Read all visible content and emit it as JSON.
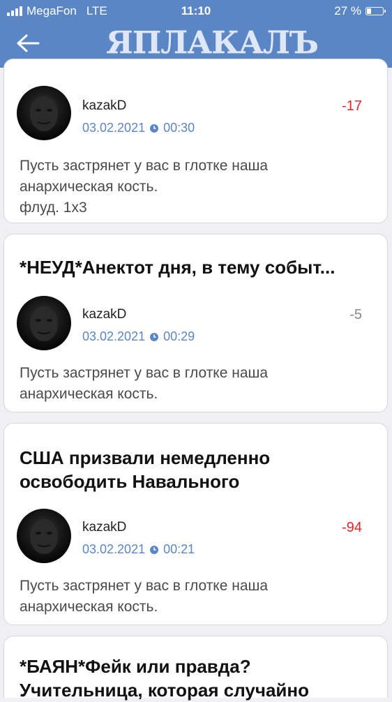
{
  "status_bar": {
    "carrier": "MegaFon",
    "network": "LTE",
    "time": "11:10",
    "battery": "27 %",
    "battery_level": 0.27
  },
  "header": {
    "logo_text": "ЯПЛАКАЛЪ",
    "back_icon": "arrow-left-icon",
    "background": "#5b86c5"
  },
  "colors": {
    "negative_score": "#e3262b",
    "neutral_score": "#888888",
    "date_link": "#5b86c5"
  },
  "posts": [
    {
      "title": "",
      "author": "kazakD",
      "date": "03.02.2021",
      "time": "00:30",
      "score": "-17",
      "body_line1": "Пусть застрянет у вас в глотке наша",
      "body_line2": "анархическая кость.",
      "body_line3": "флуд. 1x3"
    },
    {
      "title": "*НЕУД*Анектот дня, в тему событ...",
      "author": "kazakD",
      "date": "03.02.2021",
      "time": "00:29",
      "score": "-5",
      "body_line1": "Пусть застрянет у вас в глотке наша",
      "body_line2": "анархическая кость."
    },
    {
      "title_line1": "США призвали немедленно",
      "title_line2": "освободить Навального",
      "author": "kazakD",
      "date": "03.02.2021",
      "time": "00:21",
      "score": "-94",
      "body_line1": "Пусть застрянет у вас в глотке наша",
      "body_line2": "анархическая кость."
    },
    {
      "title_line1": "*БАЯН*Фейк или правда?",
      "title_line2": "Учительница, которая случайно"
    }
  ]
}
